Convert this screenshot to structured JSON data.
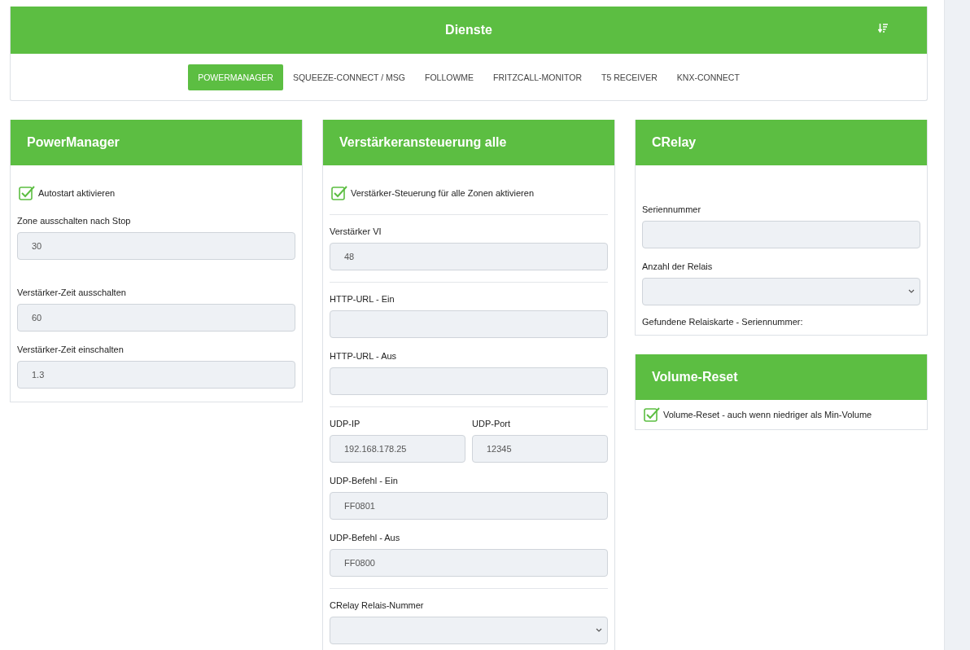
{
  "header": {
    "title": "Dienste"
  },
  "tabs": [
    {
      "label": "POWERMANAGER",
      "selected": true
    },
    {
      "label": "SQUEEZE-CONNECT / MSG",
      "selected": false
    },
    {
      "label": "FOLLOWME",
      "selected": false
    },
    {
      "label": "FRITZCALL-MONITOR",
      "selected": false
    },
    {
      "label": "T5 RECEIVER",
      "selected": false
    },
    {
      "label": "KNX-CONNECT",
      "selected": false
    }
  ],
  "columns": [
    {
      "panels": [
        {
          "title": "PowerManager",
          "items": [
            {
              "kind": "checkbox",
              "label": "Autostart aktivieren",
              "checked": true
            },
            {
              "kind": "field",
              "label": "Zone ausschalten nach Stop",
              "value": "30"
            },
            {
              "kind": "gap"
            },
            {
              "kind": "field",
              "label": "Verstärker-Zeit ausschalten",
              "value": "60"
            },
            {
              "kind": "field",
              "label": "Verstärker-Zeit einschalten",
              "value": "1.3"
            }
          ]
        }
      ]
    },
    {
      "panels": [
        {
          "title": "Verstärkeransteuerung alle",
          "items": [
            {
              "kind": "checkbox",
              "label": "Verstärker-Steuerung für alle Zonen aktivieren",
              "checked": true
            },
            {
              "kind": "divider"
            },
            {
              "kind": "field",
              "label": "Verstärker VI",
              "value": "48"
            },
            {
              "kind": "divider"
            },
            {
              "kind": "field",
              "label": "HTTP-URL - Ein"
            },
            {
              "kind": "field",
              "label": "HTTP-URL - Aus"
            },
            {
              "kind": "divider"
            },
            {
              "kind": "row",
              "fields": [
                {
                  "label": "UDP-IP",
                  "value": "192.168.178.25"
                },
                {
                  "label": "UDP-Port",
                  "value": "12345"
                }
              ]
            },
            {
              "kind": "field",
              "label": "UDP-Befehl - Ein",
              "value": "FF0801"
            },
            {
              "kind": "field",
              "label": "UDP-Befehl - Aus",
              "value": "FF0800"
            },
            {
              "kind": "divider"
            },
            {
              "kind": "select",
              "label": "CRelay Relais-Nummer"
            }
          ]
        }
      ]
    },
    {
      "panels": [
        {
          "title": "CRelay",
          "items": [
            {
              "kind": "gap"
            },
            {
              "kind": "field",
              "label": "Seriennummer"
            },
            {
              "kind": "select",
              "label": "Anzahl der Relais"
            },
            {
              "kind": "text",
              "text": "Gefundene Relaiskarte - Seriennummer:"
            }
          ]
        },
        {
          "title": "Volume-Reset",
          "items": [
            {
              "kind": "checkbox",
              "label": "Volume-Reset - auch wenn niedriger als Min-Volume",
              "checked": true
            }
          ]
        }
      ]
    }
  ]
}
